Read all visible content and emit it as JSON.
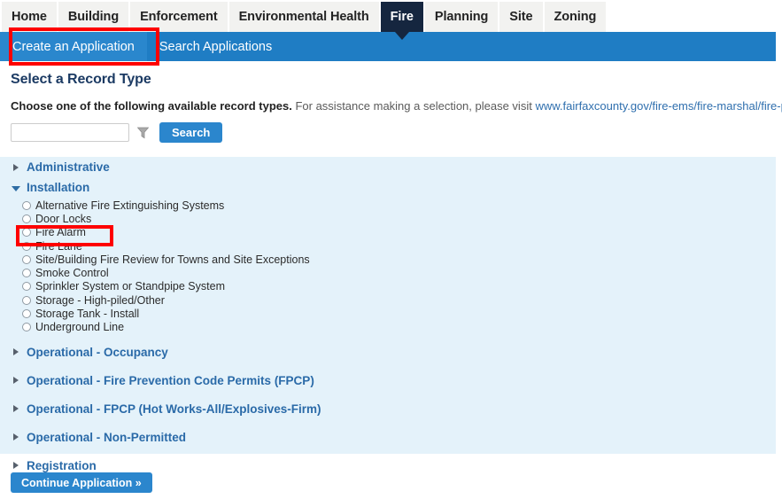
{
  "module_tabs": [
    {
      "label": "Home",
      "active": false
    },
    {
      "label": "Building",
      "active": false
    },
    {
      "label": "Enforcement",
      "active": false
    },
    {
      "label": "Environmental Health",
      "active": false
    },
    {
      "label": "Fire",
      "active": true
    },
    {
      "label": "Planning",
      "active": false
    },
    {
      "label": "Site",
      "active": false
    },
    {
      "label": "Zoning",
      "active": false
    }
  ],
  "subnav": {
    "items": [
      {
        "label": "Create an Application",
        "current": true
      },
      {
        "label": "Search Applications",
        "current": false
      }
    ]
  },
  "page": {
    "title": "Select a Record Type",
    "instruction_bold": "Choose one of the following available record types.",
    "instruction_rest": "For assistance making a selection, please visit",
    "link_text": "www.fairfaxcounty.gov/fire-ems/fire-marshal/fire-plus.",
    "link_color": "#2f6fae"
  },
  "search": {
    "value": "",
    "placeholder": "",
    "filter_icon": "funnel-icon",
    "button_label": "Search"
  },
  "record_types": {
    "sections": [
      {
        "label": "Administrative",
        "expanded": false,
        "options": []
      },
      {
        "label": "Installation",
        "expanded": true,
        "options": [
          "Alternative Fire Extinguishing Systems",
          "Door Locks",
          "Fire Alarm",
          "Fire Lane",
          "Site/Building Fire Review for Towns and Site Exceptions",
          "Smoke Control",
          "Sprinkler System or Standpipe System",
          "Storage - High-piled/Other",
          "Storage Tank - Install",
          "Underground Line"
        ]
      },
      {
        "label": "Operational - Occupancy",
        "expanded": false,
        "options": []
      },
      {
        "label": "Operational - Fire Prevention Code Permits (FPCP)",
        "expanded": false,
        "options": []
      },
      {
        "label": "Operational - FPCP (Hot Works-All/Explosives-Firm)",
        "expanded": false,
        "options": []
      },
      {
        "label": "Operational - Non-Permitted",
        "expanded": false,
        "options": []
      },
      {
        "label": "Registration",
        "expanded": false,
        "options": []
      }
    ]
  },
  "footer": {
    "continue_label": "Continue Application »"
  },
  "highlights": [
    {
      "name": "create-an-application",
      "color": "#fe0000"
    },
    {
      "name": "fire-alarm-option",
      "color": "#fe0000"
    }
  ],
  "colors": {
    "subnav_blue": "#1f7dc4",
    "active_tab_navy": "#15263f",
    "panel_blue": "#e4f2fa",
    "button_blue": "#2b86cd",
    "section_link": "#2a6aa8",
    "heading_navy": "#1b3a63"
  }
}
